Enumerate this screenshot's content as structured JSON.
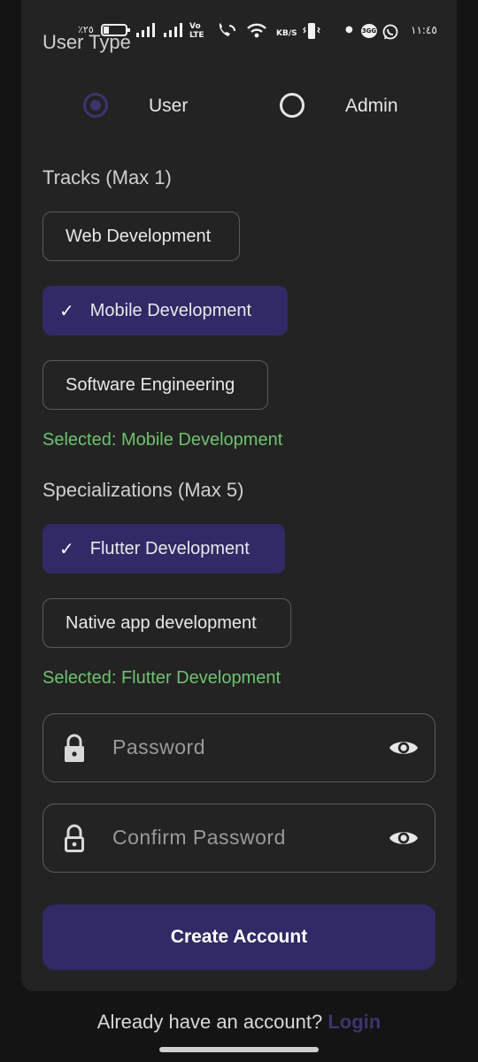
{
  "status_bar": {
    "battery_percent": "٪٢٥",
    "time": "١١:٤٥",
    "speed_unit": "KB/S",
    "volte": "Vo LTE",
    "sim_badge": "3GG"
  },
  "user_type": {
    "label": "User Type",
    "options": [
      {
        "label": "User",
        "selected": true
      },
      {
        "label": "Admin",
        "selected": false
      }
    ]
  },
  "tracks": {
    "label": "Tracks (Max 1)",
    "chips": [
      {
        "label": "Web Development",
        "selected": false
      },
      {
        "label": "Mobile Development",
        "selected": true
      },
      {
        "label": "Software Engineering",
        "selected": false
      }
    ],
    "selected_note": "Selected: Mobile Development"
  },
  "specializations": {
    "label": "Specializations (Max 5)",
    "chips": [
      {
        "label": "Flutter Development",
        "selected": true
      },
      {
        "label": "Native app development",
        "selected": false
      }
    ],
    "selected_note": "Selected: Flutter Development"
  },
  "password": {
    "placeholder": "Password",
    "confirm_placeholder": "Confirm Password"
  },
  "create_button": "Create Account",
  "footer": {
    "prompt": "Already have an account?",
    "login_link": "Login"
  },
  "colors": {
    "accent": "#312a66",
    "link": "#3d3470",
    "success_text": "#6ec26e",
    "card_bg": "#232323",
    "page_bg": "#141414"
  }
}
